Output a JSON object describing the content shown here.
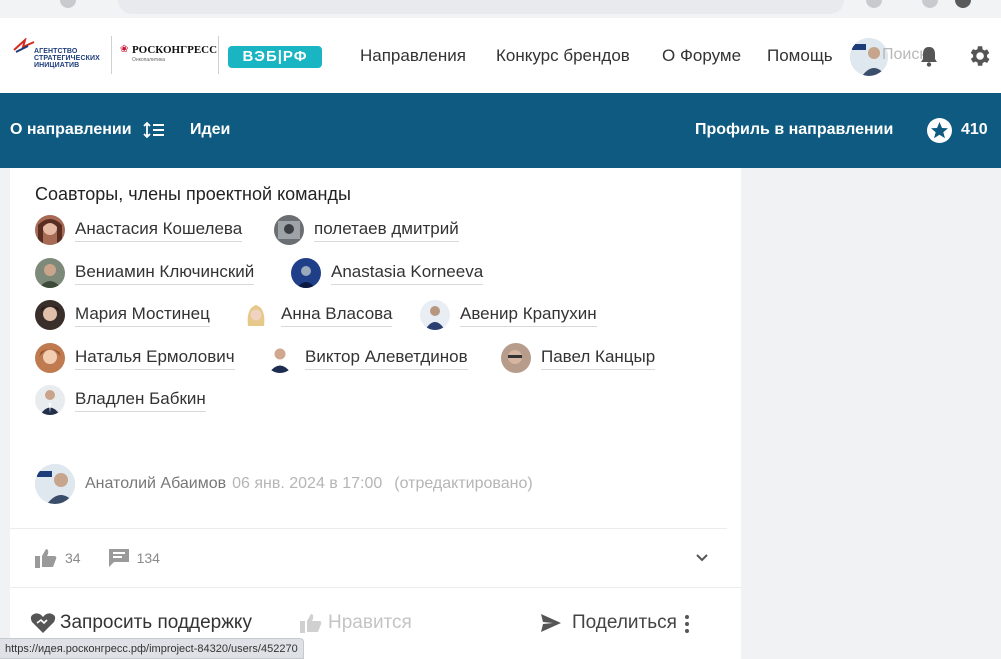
{
  "header": {
    "logo_asi": [
      "Агентство",
      "стратегических",
      "инициатив"
    ],
    "logo_rk_name": "РОСКОНГРЕСС",
    "logo_rk_sub": "Онкопалитика",
    "logo_veb": "ВЭБ|РФ",
    "nav": [
      "Направления",
      "Конкурс брендов",
      "О Форуме",
      "Помощь"
    ],
    "search_placeholder": "Поиск"
  },
  "subnav": {
    "about": "О направлении",
    "ideas": "Идеи",
    "profile": "Профиль в направлении",
    "points": "410"
  },
  "team": {
    "title": "Соавторы, члены проектной команды",
    "members": [
      "Анастасия Кошелева",
      "полетаев дмитрий",
      "Вениамин Ключинский",
      "Anastasia Korneeva",
      "Мария Мостинец",
      "Анна Власова",
      "Авенир Крапухин",
      "Наталья Ермолович",
      "Виктор Алеветдинов",
      "Павел Канцыр",
      "Владлен Бабкин"
    ]
  },
  "post": {
    "author": "Анатолий Абаимов",
    "date": "06 янв. 2024 в 17:00",
    "edited": "(отредактировано)",
    "likes": "34",
    "comments": "134"
  },
  "actions": {
    "support": "Запросить поддержку",
    "like": "Нравится",
    "share": "Поделиться"
  },
  "statusbar": {
    "url": "https://идея.росконгресс.рф/improject-84320/users/452270"
  },
  "colors": {
    "brand_blue": "#0e5a80",
    "teal": "#19b5c2"
  }
}
